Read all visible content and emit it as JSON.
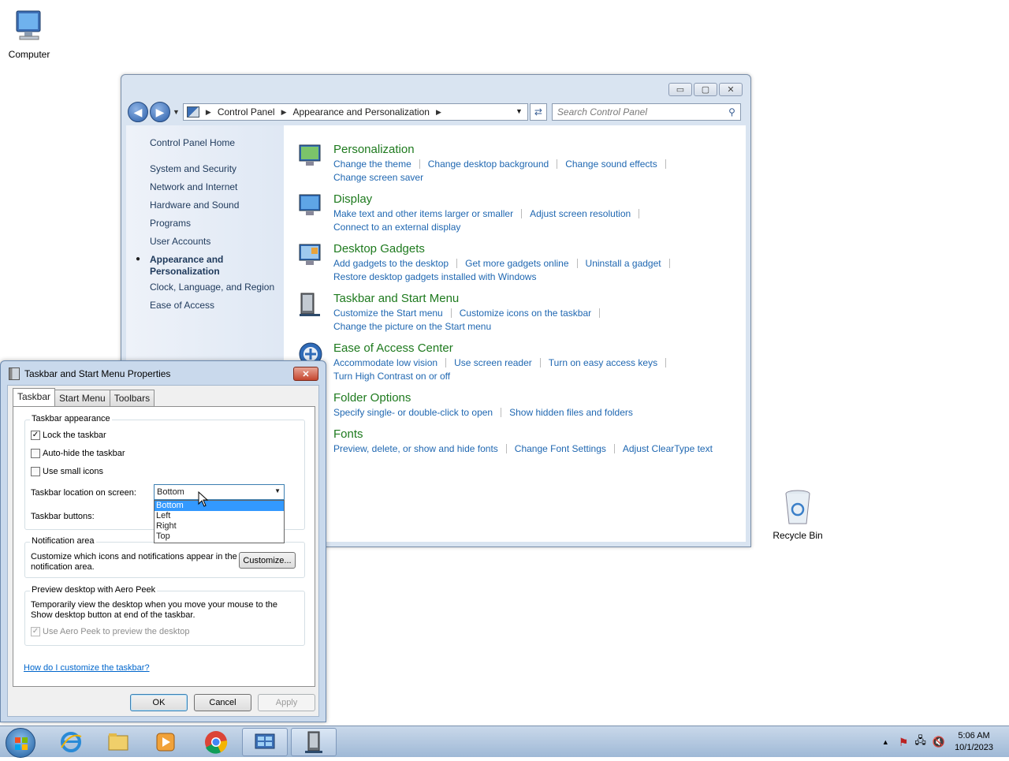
{
  "desktop": {
    "computer_label": "Computer",
    "recycle_label": "Recycle Bin"
  },
  "controlpanel": {
    "breadcrumb": [
      "Control Panel",
      "Appearance and Personalization"
    ],
    "search_placeholder": "Search Control Panel",
    "left_nav": {
      "home": "Control Panel Home",
      "items": [
        "System and Security",
        "Network and Internet",
        "Hardware and Sound",
        "Programs",
        "User Accounts"
      ],
      "current_line1": "Appearance and",
      "current_line2": "Personalization",
      "items2": [
        "Clock, Language, and Region",
        "Ease of Access"
      ]
    },
    "categories": [
      {
        "title": "Personalization",
        "links": [
          "Change the theme",
          "Change desktop background",
          "Change sound effects"
        ],
        "links2": [
          "Change screen saver"
        ]
      },
      {
        "title": "Display",
        "links": [
          "Make text and other items larger or smaller",
          "Adjust screen resolution"
        ],
        "links2": [
          "Connect to an external display"
        ]
      },
      {
        "title": "Desktop Gadgets",
        "links": [
          "Add gadgets to the desktop",
          "Get more gadgets online",
          "Uninstall a gadget"
        ],
        "links2": [
          "Restore desktop gadgets installed with Windows"
        ]
      },
      {
        "title": "Taskbar and Start Menu",
        "links": [
          "Customize the Start menu",
          "Customize icons on the taskbar"
        ],
        "links2": [
          "Change the picture on the Start menu"
        ]
      },
      {
        "title": "Ease of Access Center",
        "links": [
          "Accommodate low vision",
          "Use screen reader",
          "Turn on easy access keys"
        ],
        "links2": [
          "Turn High Contrast on or off"
        ]
      },
      {
        "title": "Folder Options",
        "links": [
          "Specify single- or double-click to open",
          "Show hidden files and folders"
        ],
        "links2": []
      },
      {
        "title": "Fonts",
        "links": [
          "Preview, delete, or show and hide fonts",
          "Change Font Settings",
          "Adjust ClearType text"
        ],
        "links2": []
      }
    ]
  },
  "dialog": {
    "title": "Taskbar and Start Menu Properties",
    "close_glyph": "✕",
    "tabs": [
      "Taskbar",
      "Start Menu",
      "Toolbars"
    ],
    "appearance_group": "Taskbar appearance",
    "lock": {
      "label": "Lock the taskbar",
      "checked": true
    },
    "autohide": {
      "label": "Auto-hide the taskbar",
      "checked": false
    },
    "small_icons": {
      "label": "Use small icons",
      "checked": false
    },
    "location_label": "Taskbar location on screen:",
    "location_value": "Bottom",
    "location_options": [
      "Bottom",
      "Left",
      "Right",
      "Top"
    ],
    "buttons_label": "Taskbar buttons:",
    "notif_group": "Notification area",
    "notif_text1": "Customize which icons and notifications appear in the",
    "notif_text2": "notification area.",
    "customize_btn": "Customize...",
    "peek_group": "Preview desktop with Aero Peek",
    "peek_text1": "Temporarily view the desktop when you move your mouse to the",
    "peek_text2": "Show desktop button at end of the taskbar.",
    "peek_chk": "Use Aero Peek to preview the desktop",
    "help_link": "How do I customize the taskbar?",
    "ok": "OK",
    "cancel": "Cancel",
    "apply": "Apply"
  },
  "taskbar": {
    "time": "5:06 AM",
    "date": "10/1/2023"
  }
}
